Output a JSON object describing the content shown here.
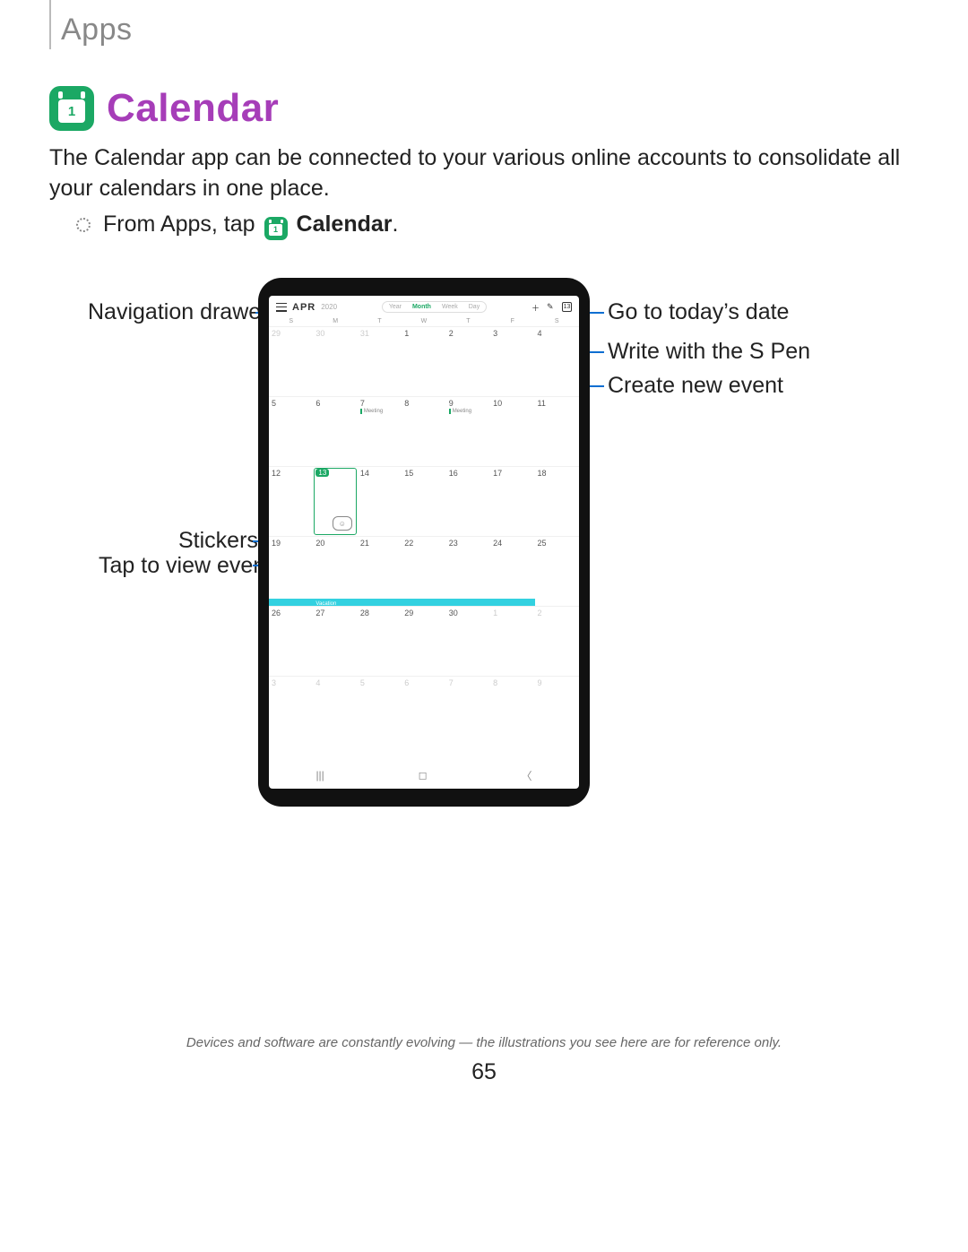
{
  "section": "Apps",
  "title": "Calendar",
  "icon_day": "1",
  "intro": "The Calendar app can be connected to your various online accounts to consolidate all your calendars in one place.",
  "step_prefix": "From Apps, tap ",
  "step_app": "Calendar",
  "step_suffix": ".",
  "callouts": {
    "nav_drawer": "Navigation drawer",
    "today": "Go to today’s date",
    "spen": "Write with the S Pen",
    "create": "Create new event",
    "stickers": "Stickers",
    "tap_event": "Tap to view event"
  },
  "tablet": {
    "month": "APR",
    "year": "2020",
    "views": [
      "Year",
      "Month",
      "Week",
      "Day"
    ],
    "active_view": "Month",
    "dow": [
      "S",
      "M",
      "T",
      "W",
      "T",
      "F",
      "S"
    ],
    "cells": [
      {
        "n": "29",
        "dim": true
      },
      {
        "n": "30",
        "dim": true
      },
      {
        "n": "31",
        "dim": true
      },
      {
        "n": "1"
      },
      {
        "n": "2"
      },
      {
        "n": "3"
      },
      {
        "n": "4"
      },
      {
        "n": "5"
      },
      {
        "n": "6"
      },
      {
        "n": "7",
        "evt": "Meeting"
      },
      {
        "n": "8"
      },
      {
        "n": "9",
        "evt": "Meeting"
      },
      {
        "n": "10"
      },
      {
        "n": "11"
      },
      {
        "n": "12"
      },
      {
        "n": "13",
        "today": true,
        "sticker": true
      },
      {
        "n": "14"
      },
      {
        "n": "15"
      },
      {
        "n": "16"
      },
      {
        "n": "17"
      },
      {
        "n": "18"
      },
      {
        "n": "19",
        "bar_start": true
      },
      {
        "n": "20",
        "bar": true,
        "bar_label": "Vacation"
      },
      {
        "n": "21",
        "bar": true
      },
      {
        "n": "22",
        "bar": true
      },
      {
        "n": "23",
        "bar": true
      },
      {
        "n": "24",
        "bar": true
      },
      {
        "n": "25"
      },
      {
        "n": "26"
      },
      {
        "n": "27"
      },
      {
        "n": "28"
      },
      {
        "n": "29"
      },
      {
        "n": "30"
      },
      {
        "n": "1",
        "dim": true
      },
      {
        "n": "2",
        "dim": true
      },
      {
        "n": "3",
        "dim": true
      },
      {
        "n": "4",
        "dim": true
      },
      {
        "n": "5",
        "dim": true
      },
      {
        "n": "6",
        "dim": true
      },
      {
        "n": "7",
        "dim": true
      },
      {
        "n": "8",
        "dim": true
      },
      {
        "n": "9",
        "dim": true
      }
    ]
  },
  "footer": "Devices and software are constantly evolving — the illustrations you see here are for reference only.",
  "page_number": "65"
}
